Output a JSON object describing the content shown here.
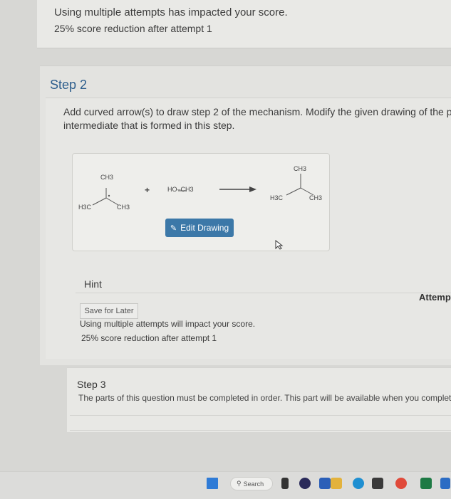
{
  "top_notice": {
    "line1": "Using multiple attempts has impacted your score.",
    "line2": "25% score reduction after attempt 1"
  },
  "step2": {
    "title": "Step 2",
    "instruction_line1": "Add curved arrow(s) to draw step 2 of the mechanism. Modify the given drawing of the product a",
    "instruction_line2": "intermediate that is formed in this step.",
    "edit_button": "Edit Drawing",
    "hint": "Hint",
    "attempt_label": "Attempt",
    "save_button": "Save for Later",
    "warning_line1": "Using multiple attempts will impact your score.",
    "warning_line2": "25% score reduction after attempt 1",
    "drawing": {
      "left_ch3_top": "CH3",
      "left_h3c": "H3C",
      "left_ch3_right": "CH3",
      "plus": "+",
      "reagent": "HO–CH3",
      "right_ch3_top": "CH3",
      "right_h3c": "H3C",
      "right_ch3_right": "CH3"
    }
  },
  "step3": {
    "title": "Step 3",
    "text": "The parts of this question must be completed in order. This part will be available when you complete t"
  },
  "taskbar": {
    "search": "Search"
  },
  "colors": {
    "accent": "#3c78a8",
    "step_title": "#2c5d8c"
  }
}
